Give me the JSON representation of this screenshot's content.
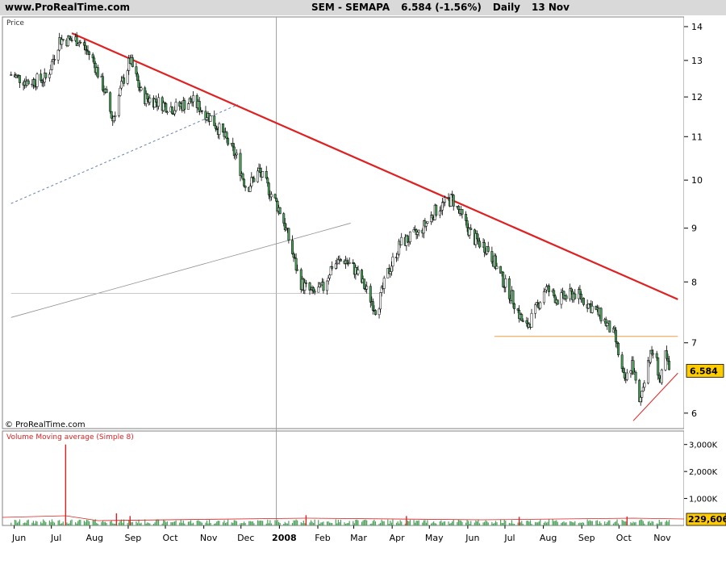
{
  "header": {
    "site": "www.ProRealTime.com",
    "symbol": "SEM - SEMAPA",
    "last_change": "6.584 (-1.56%)",
    "period": "Daily",
    "date": "13 Nov"
  },
  "colors": {
    "candle_up": "#ffffff",
    "candle_down": "#4aa05a",
    "major_trendline": "#e02020",
    "support_line": "#f0a040",
    "volume_bar": "#4aa05a",
    "volume_ma": "#e02020",
    "price_badge": "#ffcc00"
  },
  "chart_data": [
    {
      "type": "candlestick",
      "title": "SEM - SEMAPA",
      "ylabel": "Price",
      "y_scale": "log",
      "ylim": [
        5.8,
        14.3
      ],
      "y_ticks": [
        6,
        7,
        8,
        9,
        10,
        11,
        12,
        13,
        14
      ],
      "x_labels": [
        "Jun",
        "Jul",
        "Aug",
        "Sep",
        "Oct",
        "Nov",
        "Dec",
        "2008",
        "Feb",
        "Mar",
        "Apr",
        "May",
        "Jun",
        "Jul",
        "Aug",
        "Sep",
        "Oct",
        "Nov"
      ],
      "last_price": "6.584",
      "watermark": "© ProRealTime.com",
      "close_path": [
        [
          "2007-06-01",
          12.6
        ],
        [
          "2007-06-15",
          12.4
        ],
        [
          "2007-06-30",
          12.5
        ],
        [
          "2007-07-10",
          13.6
        ],
        [
          "2007-07-25",
          13.6
        ],
        [
          "2007-08-05",
          13.1
        ],
        [
          "2007-08-15",
          12.2
        ],
        [
          "2007-08-22",
          11.4
        ],
        [
          "2007-08-30",
          12.4
        ],
        [
          "2007-09-05",
          13.0
        ],
        [
          "2007-09-15",
          12.0
        ],
        [
          "2007-09-25",
          11.9
        ],
        [
          "2007-10-10",
          11.7
        ],
        [
          "2007-10-25",
          11.9
        ],
        [
          "2007-11-08",
          11.5
        ],
        [
          "2007-11-20",
          11.0
        ],
        [
          "2007-11-30",
          10.5
        ],
        [
          "2007-12-08",
          9.8
        ],
        [
          "2007-12-18",
          10.2
        ],
        [
          "2007-12-28",
          9.7
        ],
        [
          "2008-01-05",
          9.3
        ],
        [
          "2008-01-12",
          8.7
        ],
        [
          "2008-01-20",
          8.0
        ],
        [
          "2008-01-30",
          7.8
        ],
        [
          "2008-02-08",
          7.9
        ],
        [
          "2008-02-15",
          8.3
        ],
        [
          "2008-02-25",
          8.4
        ],
        [
          "2008-03-05",
          8.2
        ],
        [
          "2008-03-15",
          7.8
        ],
        [
          "2008-03-22",
          7.5
        ],
        [
          "2008-03-30",
          8.1
        ],
        [
          "2008-04-10",
          8.7
        ],
        [
          "2008-04-25",
          8.9
        ],
        [
          "2008-05-10",
          9.4
        ],
        [
          "2008-05-22",
          9.6
        ],
        [
          "2008-05-30",
          9.2
        ],
        [
          "2008-06-08",
          8.8
        ],
        [
          "2008-06-20",
          8.6
        ],
        [
          "2008-06-30",
          8.1
        ],
        [
          "2008-07-10",
          7.7
        ],
        [
          "2008-07-20",
          7.2
        ],
        [
          "2008-07-28",
          7.5
        ],
        [
          "2008-08-05",
          7.9
        ],
        [
          "2008-08-15",
          7.7
        ],
        [
          "2008-08-30",
          7.8
        ],
        [
          "2008-09-10",
          7.6
        ],
        [
          "2008-09-20",
          7.4
        ],
        [
          "2008-09-30",
          7.1
        ],
        [
          "2008-10-08",
          6.4
        ],
        [
          "2008-10-14",
          6.7
        ],
        [
          "2008-10-20",
          6.1
        ],
        [
          "2008-10-26",
          6.7
        ],
        [
          "2008-11-01",
          6.9
        ],
        [
          "2008-11-06",
          6.4
        ],
        [
          "2008-11-10",
          6.8
        ],
        [
          "2008-11-13",
          6.58
        ]
      ],
      "trendlines": [
        {
          "points": [
            [
              "2007-07-20",
              13.8
            ],
            [
              "2008-11-20",
              7.7
            ]
          ],
          "style": "solid-thick"
        },
        {
          "points": [
            [
              "2008-06-25",
              7.1
            ],
            [
              "2008-11-20",
              7.1
            ]
          ],
          "style": "solid-thin"
        },
        {
          "points": [
            [
              "2008-10-15",
              5.9
            ],
            [
              "2008-11-20",
              6.55
            ]
          ],
          "style": "solid-thin"
        },
        {
          "points": [
            [
              "2007-06-01",
              9.5
            ],
            [
              "2007-12-01",
              11.8
            ]
          ],
          "style": "dashed"
        },
        {
          "points": [
            [
              "2007-06-01",
              7.4
            ],
            [
              "2008-03-01",
              9.1
            ]
          ],
          "style": "gray"
        },
        {
          "points": [
            [
              "2007-06-01",
              7.8
            ],
            [
              "2008-03-25",
              7.8
            ]
          ],
          "style": "gray-horizontal"
        }
      ]
    },
    {
      "type": "bar",
      "title": "Volume Moving average (Simple 8)",
      "ylim": [
        0,
        3500000
      ],
      "y_ticks": [
        "1,000K",
        "2,000K",
        "3,000K"
      ],
      "last_value": "229,606",
      "spikes": [
        [
          "2007-07-15",
          3000000
        ],
        [
          "2007-08-25",
          450000
        ],
        [
          "2007-09-05",
          350000
        ],
        [
          "2008-01-25",
          380000
        ],
        [
          "2008-04-15",
          350000
        ],
        [
          "2008-07-15",
          320000
        ],
        [
          "2008-10-10",
          330000
        ]
      ]
    }
  ]
}
